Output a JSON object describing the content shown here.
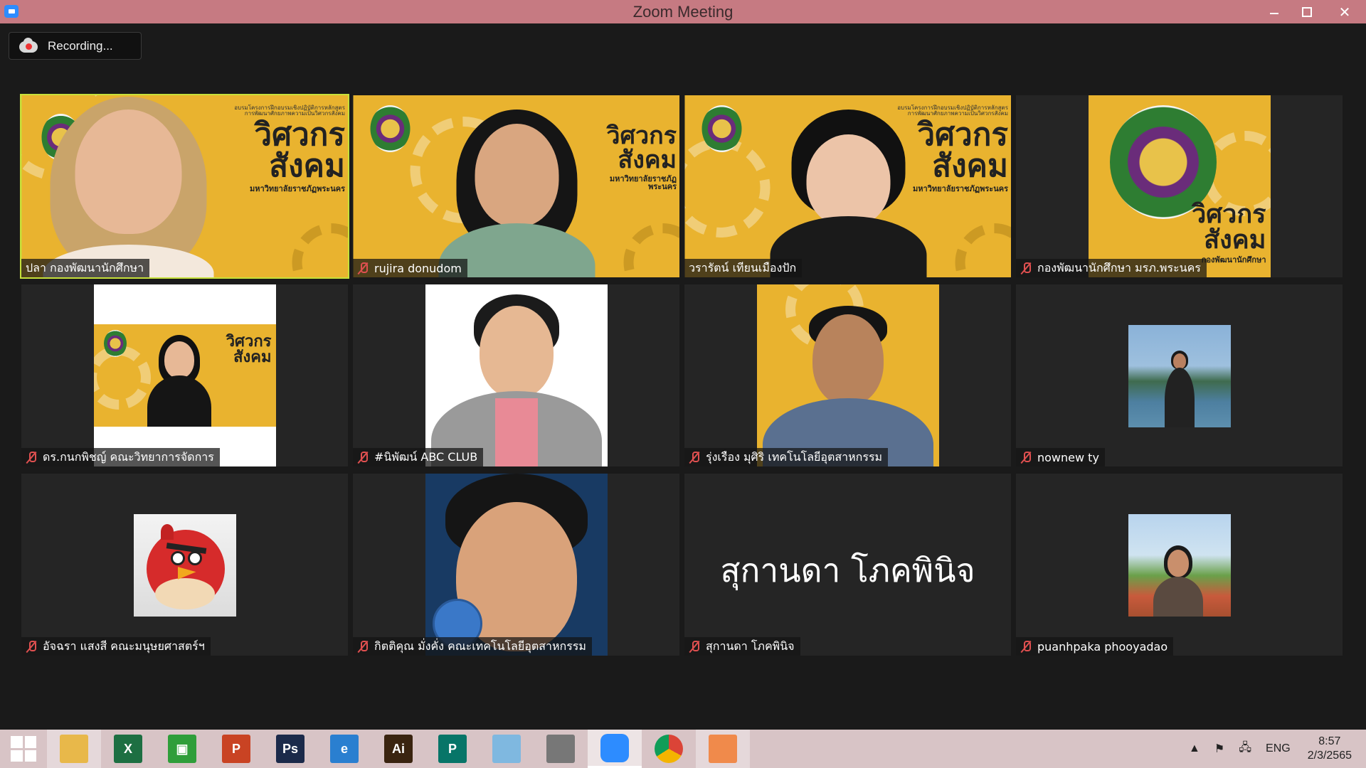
{
  "window": {
    "title": "Zoom Meeting",
    "close_glyph": "✕"
  },
  "recording": {
    "label": "Recording..."
  },
  "participants": [
    {
      "name": "ปลา กองพัฒนานักศึกษา",
      "muted": false,
      "active": true
    },
    {
      "name": "rujira donudom",
      "muted": true
    },
    {
      "name": "วรารัตน์ เทียนเมืองปัก",
      "muted": false
    },
    {
      "name": "กองพัฒนานักศึกษา มรภ.พระนคร",
      "muted": true
    },
    {
      "name": "ดร.กนกพิชญ์ คณะวิทยาการจัดการ",
      "muted": true
    },
    {
      "name": "#นิพัฒน์ ABC CLUB",
      "muted": true
    },
    {
      "name": "รุ่งเรือง มุศิริ เทคโนโลยีอุตสาหกรรม",
      "muted": true
    },
    {
      "name": "nownew ty",
      "muted": true
    },
    {
      "name": "อัจฉรา แสงสี คณะมนุษยศาสตร์ฯ",
      "muted": true
    },
    {
      "name": "กิตติคุณ มั่งคั่ง คณะเทคโนโลยีอุตสาหกรรม",
      "muted": true
    },
    {
      "name": "สุกานดา โภคพินิจ",
      "muted": true,
      "display_text": "สุกานดา โภคพินิจ"
    },
    {
      "name": "puanhpaka phooyadao",
      "muted": true
    }
  ],
  "background_brand": {
    "heading": "วิศวกรสังคม",
    "university": "มหาวิทยาลัยราชภัฏพระนคร",
    "small": "อบรมโครงการฝึกอบรมเชิงปฏิบัติการหลักสูตรการพัฒนาศักยภาพความเป็นวิศวกรสังคม"
  },
  "unit_label": "กองพัฒนานักศึกษา",
  "taskbar": {
    "apps": [
      {
        "id": "file-explorer",
        "label": "",
        "color": "#e8b84a"
      },
      {
        "id": "excel",
        "label": "X",
        "color": "#1d6f42"
      },
      {
        "id": "store",
        "label": "▣",
        "color": "#2f9e3a"
      },
      {
        "id": "powerpoint",
        "label": "P",
        "color": "#c94323"
      },
      {
        "id": "photoshop",
        "label": "Ps",
        "color": "#1b2a4a"
      },
      {
        "id": "internet-explorer",
        "label": "e",
        "color": "#2a7fd0"
      },
      {
        "id": "illustrator",
        "label": "Ai",
        "color": "#3a2410"
      },
      {
        "id": "publisher",
        "label": "P",
        "color": "#077568"
      },
      {
        "id": "notes",
        "label": "",
        "color": "#7fb8e0"
      },
      {
        "id": "photoscape",
        "label": "",
        "color": "#777777"
      },
      {
        "id": "zoom",
        "label": "",
        "color": "#2d8cff"
      },
      {
        "id": "chrome",
        "label": "",
        "color": "#e0e0e0"
      },
      {
        "id": "photos",
        "label": "",
        "color": "#f08a4b"
      }
    ],
    "language": "ENG",
    "time": "8:57",
    "date": "2/3/2565"
  }
}
